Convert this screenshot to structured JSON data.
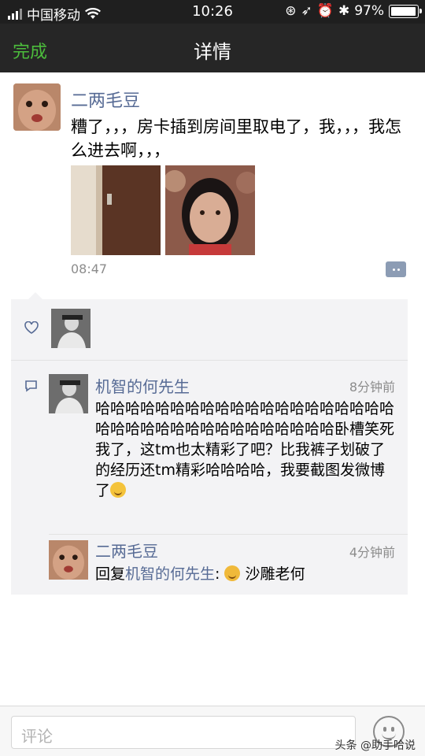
{
  "status_bar": {
    "carrier": "中国移动",
    "time": "10:26",
    "battery_percent": "97%",
    "battery_level": 0.97
  },
  "nav": {
    "done_label": "完成",
    "title": "详情"
  },
  "post": {
    "author": "二两毛豆",
    "text": "糟了，，，房卡插到房间里取电了，我，，，我怎么进去啊，，，",
    "time": "08:47"
  },
  "comments": [
    {
      "name": "机智的何先生",
      "time": "8分钟前",
      "text": "哈哈哈哈哈哈哈哈哈哈哈哈哈哈哈哈哈哈哈哈哈哈哈哈哈哈哈哈哈哈哈哈哈哈哈哈卧槽笑死我了，这tm也太精彩了吧？比我裤子划破了的经历还tm精彩哈哈哈哈，我要截图发微博了"
    },
    {
      "name": "二两毛豆",
      "time": "4分钟前",
      "reply_prefix": "回复",
      "reply_to": "机智的何先生",
      "reply_colon": ":",
      "text": "沙雕老何"
    }
  ],
  "comment_input": {
    "placeholder": "评论"
  },
  "watermark": "头条 @助手哈说",
  "colors": {
    "link": "#576b95",
    "done": "#4cbd3c",
    "navbar": "#262626"
  }
}
